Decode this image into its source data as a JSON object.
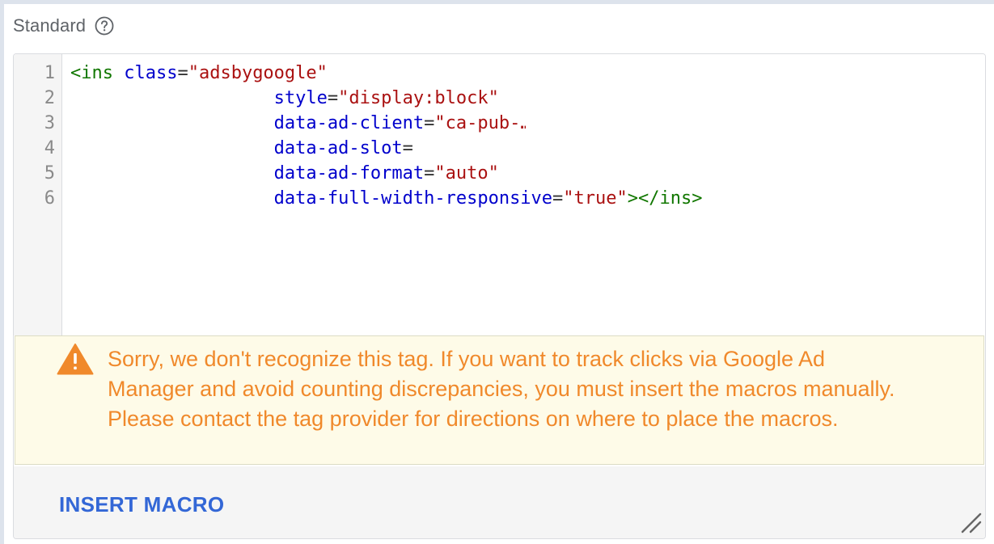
{
  "section": {
    "title": "Standard",
    "help_icon": "question-circle-icon"
  },
  "editor": {
    "line_numbers": [
      "1",
      "2",
      "3",
      "4",
      "5",
      "6"
    ],
    "lines": [
      [
        {
          "text": "<ins",
          "type": "tag"
        },
        {
          "text": " ",
          "type": "punc"
        },
        {
          "text": "class",
          "type": "attr"
        },
        {
          "text": "=",
          "type": "punc"
        },
        {
          "text": "\"adsbygoogle\"",
          "type": "str"
        }
      ],
      [
        {
          "text": "                   ",
          "type": "punc"
        },
        {
          "text": "style",
          "type": "attr"
        },
        {
          "text": "=",
          "type": "punc"
        },
        {
          "text": "\"display:block\"",
          "type": "str"
        }
      ],
      [
        {
          "text": "                   ",
          "type": "punc"
        },
        {
          "text": "data-ad-client",
          "type": "attr"
        },
        {
          "text": "=",
          "type": "punc"
        },
        {
          "text": "\"ca-pub-…",
          "type": "str",
          "clip_chars": 8.5
        }
      ],
      [
        {
          "text": "                   ",
          "type": "punc"
        },
        {
          "text": "data-ad-slot",
          "type": "attr"
        },
        {
          "text": "=",
          "type": "punc"
        }
      ],
      [
        {
          "text": "                   ",
          "type": "punc"
        },
        {
          "text": "data-ad-format",
          "type": "attr"
        },
        {
          "text": "=",
          "type": "punc"
        },
        {
          "text": "\"auto\"",
          "type": "str"
        }
      ],
      [
        {
          "text": "                   ",
          "type": "punc"
        },
        {
          "text": "data-full-width-responsive",
          "type": "attr"
        },
        {
          "text": "=",
          "type": "punc"
        },
        {
          "text": "\"true\"",
          "type": "str"
        },
        {
          "text": "></ins>",
          "type": "tag"
        }
      ]
    ]
  },
  "warning": {
    "icon": "warning-triangle-icon",
    "text": "Sorry, we don't recognize this tag. If you want to track clicks via Google Ad Manager and avoid counting discrepancies, you must insert the macros manually. Please contact the tag provider for directions on where to place the macros.",
    "color": "#f0892b",
    "background": "#fefbe8"
  },
  "footer": {
    "insert_macro_label": "INSERT MACRO",
    "resize_icon": "resize-handle-icon"
  },
  "colors": {
    "tag": "#117700",
    "attribute": "#0000cc",
    "string": "#aa1111",
    "link": "#3367d6"
  }
}
